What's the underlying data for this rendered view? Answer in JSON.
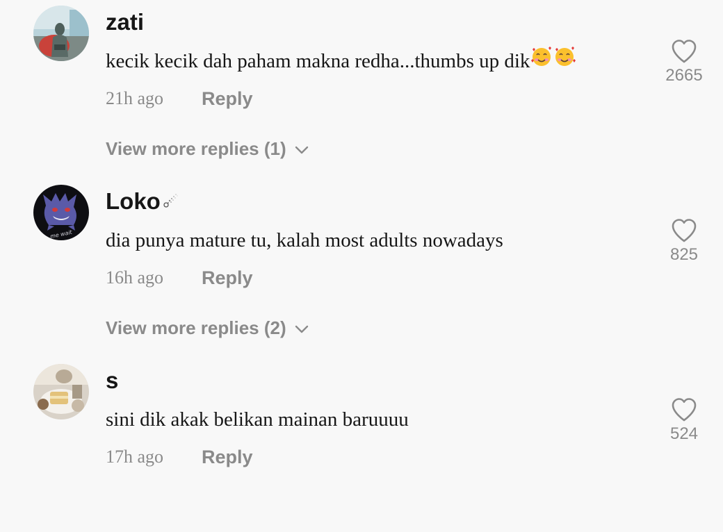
{
  "comments": [
    {
      "username": "zati",
      "text": "kecik kecik dah paham makna redha...thumbs up dik",
      "emoji": "smiling-face-with-hearts x2",
      "time": "21h ago",
      "reply_label": "Reply",
      "likes": "2665",
      "view_more": "View more replies (1)"
    },
    {
      "username": "Loko",
      "username_suffix_icon": "comet-sparkle-icon",
      "text": "dia punya mature tu, kalah most adults nowadays",
      "time": "16h ago",
      "reply_label": "Reply",
      "likes": "825",
      "view_more": "View more replies (2)",
      "avatar_text": "me wait"
    },
    {
      "username": "s",
      "text": "sini dik akak belikan mainan baruuuu",
      "time": "17h ago",
      "reply_label": "Reply",
      "likes": "524"
    }
  ],
  "colors": {
    "background": "#f8f8f8",
    "username": "#161616",
    "text": "#161616",
    "muted": "#8a8a8a"
  }
}
